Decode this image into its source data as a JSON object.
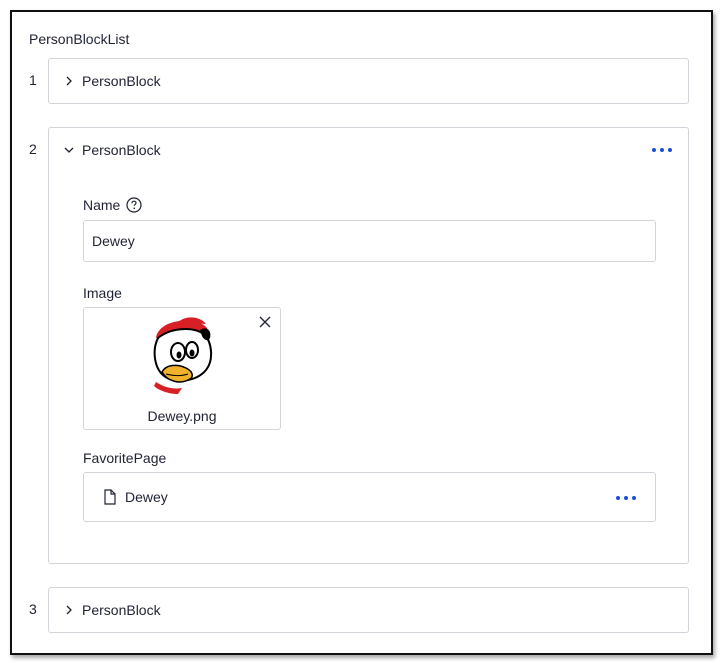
{
  "list": {
    "title": "PersonBlockList",
    "items": [
      {
        "index": "1",
        "label": "PersonBlock",
        "expanded": false
      },
      {
        "index": "2",
        "label": "PersonBlock",
        "expanded": true,
        "fields": {
          "name_label": "Name",
          "name_value": "Dewey",
          "image_label": "Image",
          "image_filename": "Dewey.png",
          "favorite_label": "FavoritePage",
          "favorite_value": "Dewey"
        }
      },
      {
        "index": "3",
        "label": "PersonBlock",
        "expanded": false
      }
    ]
  },
  "icons": {
    "collapsed": "chevron-right-icon",
    "expanded": "chevron-down-icon",
    "more": "more-options-icon",
    "help": "help-circle-icon",
    "remove": "close-icon",
    "page": "document-icon"
  },
  "colors": {
    "accent": "#1f4fd6",
    "border": "#d3d4da",
    "text": "#1f2233"
  }
}
